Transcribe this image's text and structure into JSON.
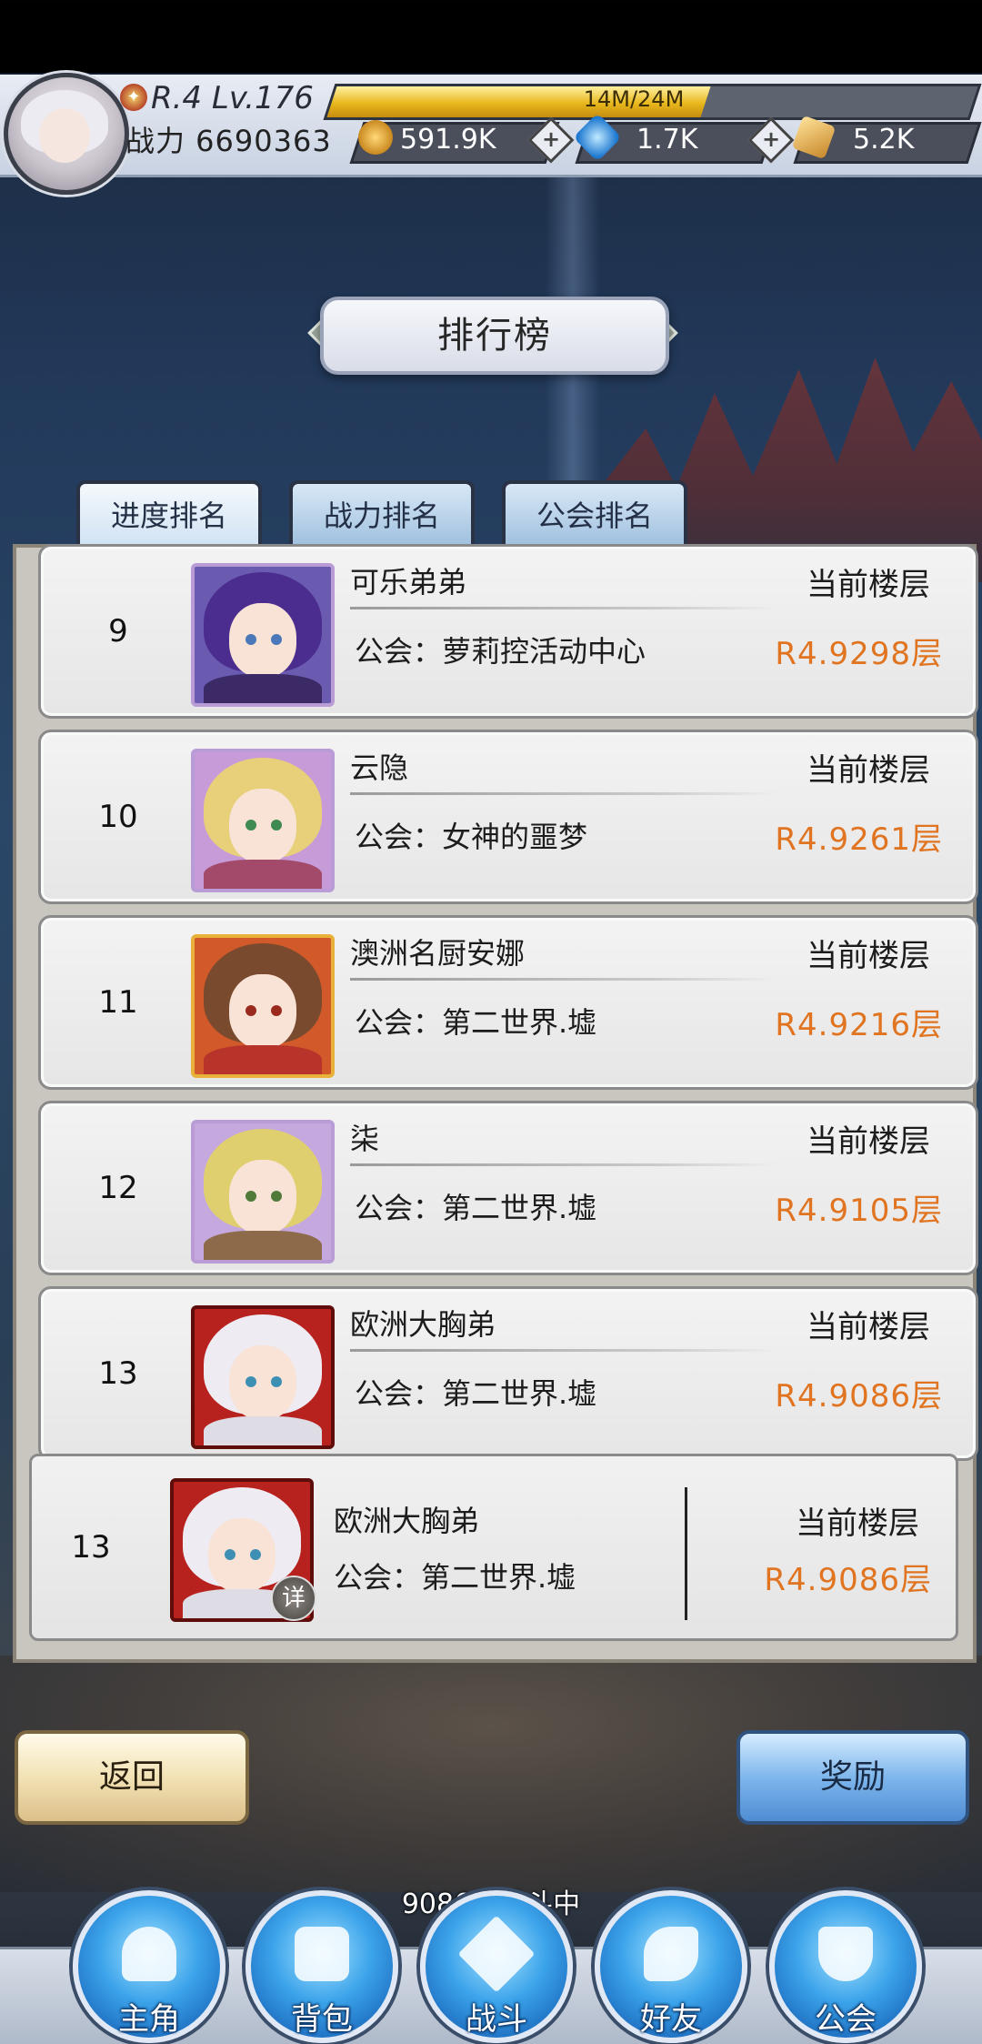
{
  "player": {
    "level_text": "R.4 Lv.176",
    "exp_text": "14M/24M",
    "exp_fraction": 0.583,
    "power_text": "战力 6690363"
  },
  "resources": {
    "gold": "591.9K",
    "gems": "1.7K",
    "tickets": "5.2K"
  },
  "title": "排行榜",
  "tabs": [
    "进度排名",
    "战力排名",
    "公会排名"
  ],
  "active_tab": "进度排名",
  "rows": [
    {
      "rank": "9",
      "name": "可乐弟弟",
      "guild": "公会：萝莉控活动中心",
      "floor_label": "当前楼层",
      "floor": "R4.9298层"
    },
    {
      "rank": "10",
      "name": "云隐",
      "guild": "公会：女神的噩梦",
      "floor_label": "当前楼层",
      "floor": "R4.9261层"
    },
    {
      "rank": "11",
      "name": "澳洲名厨安娜",
      "guild": "公会：第二世界.墟",
      "floor_label": "当前楼层",
      "floor": "R4.9216层"
    },
    {
      "rank": "12",
      "name": "柒",
      "guild": "公会：第二世界.墟",
      "floor_label": "当前楼层",
      "floor": "R4.9105层"
    },
    {
      "rank": "13",
      "name": "欧洲大胸弟",
      "guild": "公会：第二世界.墟",
      "floor_label": "当前楼层",
      "floor": "R4.9086层"
    }
  ],
  "self_row": {
    "rank": "13",
    "name": "欧洲大胸弟",
    "guild": "公会：第二世界.墟",
    "floor_label": "当前楼层",
    "floor": "R4.9086层",
    "detail_badge": "详"
  },
  "buttons": {
    "back": "返回",
    "reward": "奖励"
  },
  "battle_status": "9086层战斗中",
  "nav": [
    "主角",
    "背包",
    "战斗",
    "好友",
    "公会"
  ],
  "colors": {
    "floor_value": "#e07420",
    "exp_fill": "#e8b71c",
    "nav_button": "#3ba3ea"
  }
}
